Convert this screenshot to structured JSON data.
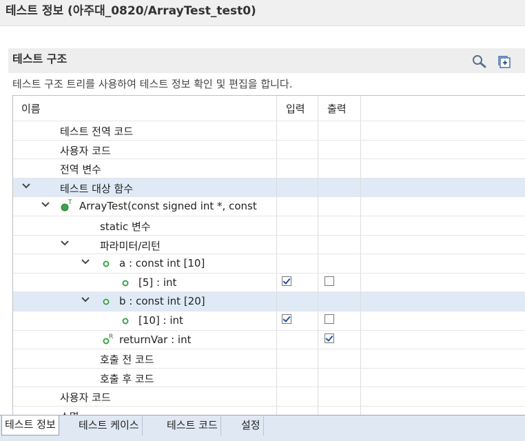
{
  "title": "테스트 정보 (아주대_0820/ArrayTest_test0)",
  "section": {
    "title": "테스트 구조",
    "description": "테스트 구조 트리를 사용하여 테스트 정보 확인 및 편집을 합니다."
  },
  "tree": {
    "columns": {
      "name": "이름",
      "input": "입력",
      "output": "출력"
    },
    "rows": [
      {
        "label": "테스트 전역 코드"
      },
      {
        "label": "사용자 코드"
      },
      {
        "label": "전역 변수"
      },
      {
        "label": "테스트 대상 함수"
      },
      {
        "label": "ArrayTest(const signed int *, const"
      },
      {
        "label": "static 변수"
      },
      {
        "label": "파라미터/리턴"
      },
      {
        "label": "a  :  const int  [10]"
      },
      {
        "label": "[5]  :  int",
        "input": true,
        "output": false
      },
      {
        "label": "b  :  const int  [20]"
      },
      {
        "label": "[10]  :  int",
        "input": true,
        "output": false
      },
      {
        "label": "returnVar  :  int",
        "output": true
      },
      {
        "label": "호출 전 코드"
      },
      {
        "label": "호출 후 코드"
      },
      {
        "label": "사용자 코드"
      },
      {
        "label": "소멸"
      }
    ]
  },
  "tabs": [
    "테스트 정보",
    "테스트 케이스",
    "테스트 코드",
    "설정"
  ],
  "icons": {
    "search": "search-icon",
    "expand": "expand-all-icon",
    "function": "function-icon",
    "variable": "variable-icon",
    "return": "return-icon"
  },
  "colors": {
    "selected_row": "#dfeaf6",
    "icon_green": "#3aa54a",
    "tab_bar": "#dfe8f3"
  }
}
